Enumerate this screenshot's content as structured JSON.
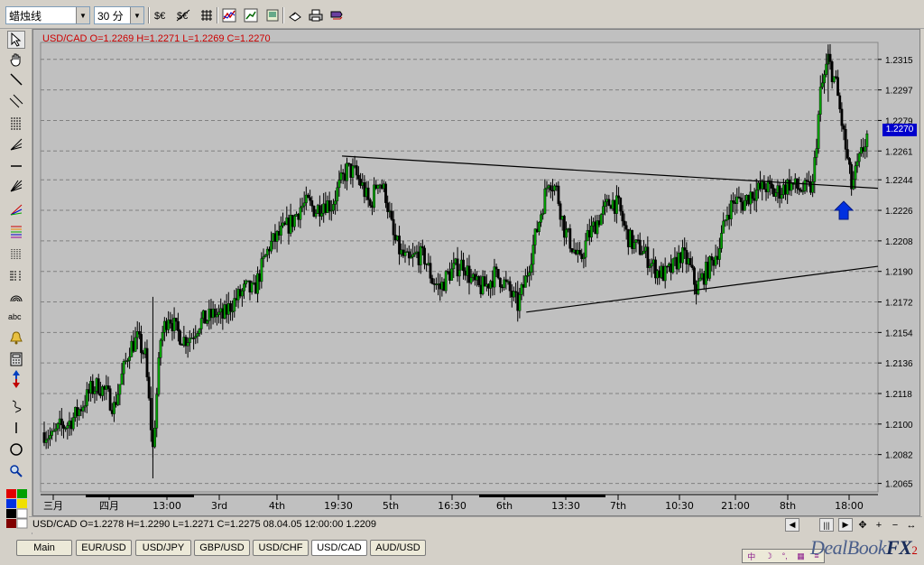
{
  "toolbar": {
    "chart_type": "蜡烛线",
    "timeframe": "30 分",
    "buttons": [
      "currency-icon",
      "currency-strike-icon",
      "crosshair-grid-icon",
      "indicator-icon",
      "chart-properties-icon",
      "template-icon",
      "open-icon",
      "print-icon",
      "settings-icon"
    ]
  },
  "tools": [
    "cursor-icon",
    "hand-icon",
    "trendline-icon",
    "channel-icon",
    "fibonacci-icon",
    "fan-icon",
    "horizontal-line-icon",
    "retracement-icon",
    "speed-resistance-icon",
    "color-levels-icon",
    "grid-levels-icon",
    "fib-timezone-icon",
    "arc-icon",
    "text-abc-icon",
    "alert-bell-icon",
    "calculator-icon",
    "up-down-arrow-icon",
    "wave-icon",
    "vertical-line-icon",
    "circle-icon",
    "zoom-icon",
    "color-palette-icon"
  ],
  "chart": {
    "ohlc_label": "USD/CAD O=1.2269 H=1.2271 L=1.2269 C=1.2270",
    "current_price": "1.2270",
    "y_ticks": [
      "1.2315",
      "1.2297",
      "1.2279",
      "1.2261",
      "1.2244",
      "1.2226",
      "1.2208",
      "1.2190",
      "1.2172",
      "1.2154",
      "1.2136",
      "1.2118",
      "1.2100",
      "1.2082",
      "1.2065"
    ],
    "x_ticks": [
      "三月",
      "四月",
      "13:00",
      "3rd",
      "4th",
      "19:30",
      "5th",
      "16:30",
      "6th",
      "13:30",
      "7th",
      "10:30",
      "21:00",
      "8th",
      "18:00"
    ]
  },
  "chart_data": {
    "type": "candlestick",
    "title": "USD/CAD O=1.2269 H=1.2271 L=1.2269 C=1.2270",
    "ylim": [
      1.206,
      1.2325
    ],
    "trendlines": [
      {
        "from": [
          0.36,
          1.2258
        ],
        "to": [
          1.0,
          1.2239
        ]
      },
      {
        "from": [
          0.58,
          1.2166
        ],
        "to": [
          1.0,
          1.2193
        ]
      }
    ],
    "series": [
      {
        "name": "USD/CAD",
        "values": [
          1.2095,
          1.2092,
          1.2098,
          1.21,
          1.2105,
          1.2112,
          1.212,
          1.2123,
          1.2118,
          1.211,
          1.2128,
          1.2145,
          1.215,
          1.214,
          1.2085,
          1.215,
          1.2165,
          1.2155,
          1.215,
          1.2152,
          1.216,
          1.2162,
          1.2165,
          1.2163,
          1.217,
          1.2175,
          1.218,
          1.2178,
          1.2192,
          1.2205,
          1.221,
          1.2215,
          1.222,
          1.2228,
          1.223,
          1.2226,
          1.2231,
          1.2229,
          1.224,
          1.225,
          1.2248,
          1.224,
          1.2228,
          1.2245,
          1.2235,
          1.221,
          1.22,
          1.2195,
          1.22,
          1.2198,
          1.2185,
          1.218,
          1.2188,
          1.2192,
          1.2195,
          1.2185,
          1.218,
          1.2182,
          1.2188,
          1.2185,
          1.2178,
          1.217,
          1.2185,
          1.2205,
          1.2225,
          1.2245,
          1.2238,
          1.2215,
          1.2205,
          1.2195,
          1.221,
          1.2218,
          1.2225,
          1.2232,
          1.2228,
          1.2212,
          1.2205,
          1.2203,
          1.2196,
          1.219,
          1.2188,
          1.2192,
          1.22,
          1.2195,
          1.218,
          1.2188,
          1.2195,
          1.2205,
          1.2225,
          1.2232,
          1.223,
          1.2236,
          1.2238,
          1.224,
          1.2236,
          1.2238,
          1.2242,
          1.2239,
          1.2238,
          1.224,
          1.2295,
          1.2315,
          1.23,
          1.227,
          1.224,
          1.2255,
          1.227
        ]
      }
    ]
  },
  "status": {
    "text": "USD/CAD O=1.2278 H=1.2290 L=1.2271 C=1.2275   08.04.05 12:00:00 1.2209"
  },
  "tabs": [
    "Main",
    "EUR/USD",
    "USD/JPY",
    "GBP/USD",
    "USD/CHF",
    "USD/CAD",
    "AUD/USD"
  ],
  "brand": {
    "name": "DealBook",
    "fx": "FX",
    "sub": "2"
  }
}
